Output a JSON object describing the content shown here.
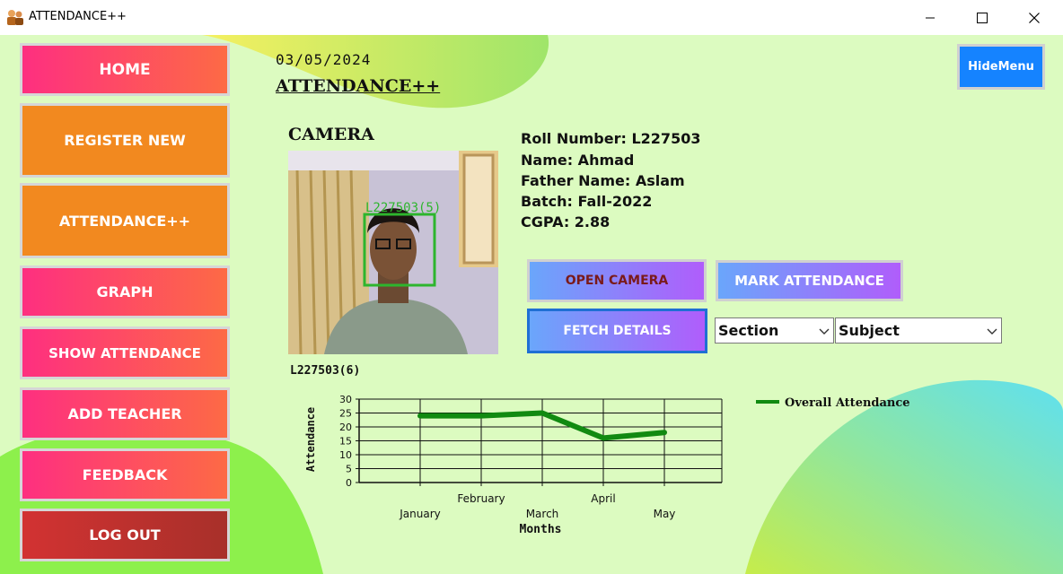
{
  "window": {
    "title": "ATTENDANCE++",
    "controls": [
      "minimize",
      "maximize",
      "close"
    ]
  },
  "sidebar": {
    "items": [
      {
        "label": "HOME"
      },
      {
        "label": "REGISTER NEW"
      },
      {
        "label": "ATTENDANCE++"
      },
      {
        "label": "GRAPH"
      },
      {
        "label": "SHOW ATTENDANCE"
      },
      {
        "label": "ADD TEACHER"
      },
      {
        "label": "FEEDBACK"
      },
      {
        "label": "LOG OUT"
      }
    ]
  },
  "header": {
    "date": "03/05/2024",
    "title": "ATTENDANCE++",
    "hide_menu": "HideMenu"
  },
  "camera": {
    "label": "CAMERA",
    "overlay_text": "L227503(5)",
    "caption": "L227503(6)"
  },
  "student": {
    "roll": "Roll Number: L227503",
    "name": "Name: Ahmad",
    "father": "Father Name: Aslam",
    "batch": "Batch: Fall-2022",
    "cgpa": "CGPA: 2.88"
  },
  "actions": {
    "open_camera": "OPEN CAMERA",
    "mark_attendance": "MARK ATTENDANCE",
    "fetch_details": "FETCH DETAILS"
  },
  "selects": {
    "section": "Section",
    "subject": "Subject"
  },
  "colors": {
    "background": "#dcfbc0",
    "line": "#118a11",
    "pink": "#fe2f80",
    "orange": "#f2891f",
    "red": "#c8302f",
    "blue": "#1583ff"
  },
  "chart_data": {
    "type": "line",
    "categories": [
      "January",
      "February",
      "March",
      "April",
      "May"
    ],
    "series": [
      {
        "name": "Overall Attendance",
        "values": [
          24,
          24,
          25,
          16,
          18
        ]
      }
    ],
    "xlabel": "Months",
    "ylabel": "Attendance",
    "ylim": [
      0,
      30
    ],
    "yticks": [
      0,
      5,
      10,
      15,
      20,
      25,
      30
    ],
    "grid": true,
    "legend": "top-right"
  }
}
